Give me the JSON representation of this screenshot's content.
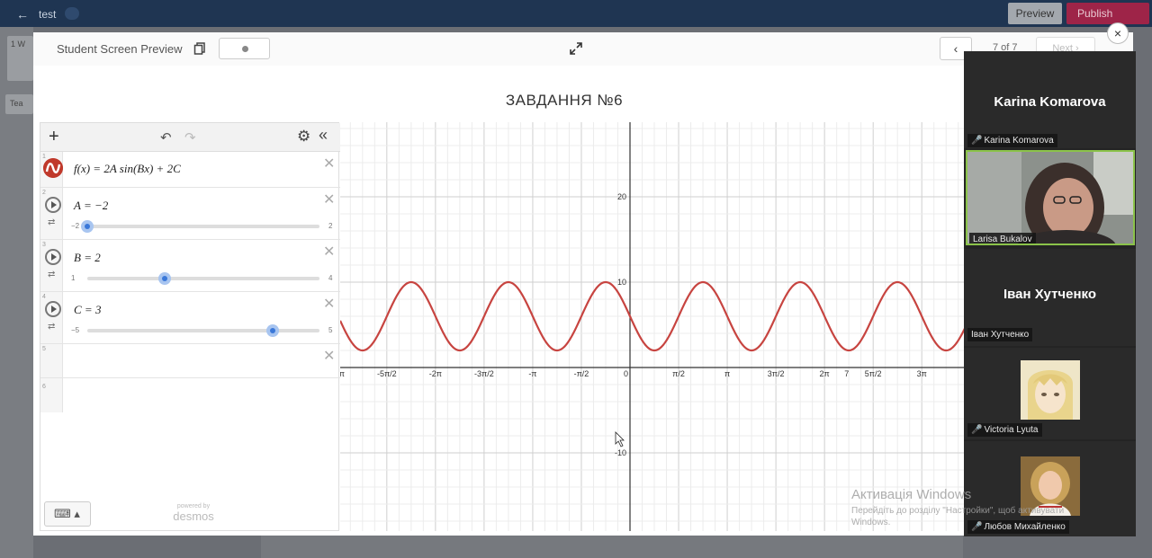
{
  "topbar": {
    "back_glyph": "←",
    "title": "test",
    "preview_label": "Preview",
    "publish_label": "Publish"
  },
  "background": {
    "card_label": "1 W",
    "card2_label": "Tea"
  },
  "header": {
    "preview_title": "Student Screen Preview",
    "page_counter": "7 of 7",
    "next_label": "Next",
    "prev_glyph": "‹",
    "close_glyph": "×"
  },
  "task": {
    "title": "ЗАВДАННЯ №6"
  },
  "expressions": [
    {
      "num": "1",
      "type": "function",
      "latex_text": "f(x) = 2A sin(Bx) + 2C"
    },
    {
      "num": "2",
      "type": "slider",
      "label": "A = −2",
      "min": "−2",
      "max": "2",
      "value": -2,
      "range": [
        -2,
        2
      ]
    },
    {
      "num": "3",
      "type": "slider",
      "label": "B = 2",
      "min": "1",
      "max": "4",
      "value": 2,
      "range": [
        1,
        4
      ]
    },
    {
      "num": "4",
      "type": "slider",
      "label": "C = 3",
      "min": "−5",
      "max": "5",
      "value": 3,
      "range": [
        -5,
        5
      ]
    },
    {
      "num": "5",
      "type": "empty"
    },
    {
      "num": "6",
      "type": "empty"
    }
  ],
  "toolbar": {
    "plus": "+",
    "undo": "↶",
    "redo": "↷",
    "gear": "⚙",
    "collapse": "«"
  },
  "desmos": {
    "powered_by": "powered by",
    "brand": "desmos",
    "keyboard_glyph": "⌨ ▴"
  },
  "chart_data": {
    "type": "line",
    "function": "f(x) = 2A sin(Bx) + 2C",
    "params": {
      "A": -2,
      "B": 2,
      "C": 3
    },
    "x_ticks": [
      "-3π",
      "-5π/2",
      "-2π",
      "-3π/2",
      "-π",
      "-π/2",
      "0",
      "π/2",
      "π",
      "3π/2",
      "2π",
      "5π/2",
      "3π",
      "7"
    ],
    "y_ticks": [
      "20",
      "10",
      "-10"
    ],
    "xlim": [
      -9.7,
      14.5
    ],
    "ylim": [
      -19,
      29
    ],
    "series_color": "#c74440",
    "grid": true
  },
  "participants": [
    {
      "name": "Karina Komarova",
      "big_name": "Karina Komarova",
      "muted": true,
      "video": false
    },
    {
      "name": "Larisa Bukalov",
      "muted": false,
      "video": true
    },
    {
      "name": "Іван Хутченко",
      "big_name": "Іван Хутченко",
      "muted": false,
      "video": false
    },
    {
      "name": "Victoria Lyuta",
      "muted": true,
      "video": false,
      "avatar": "anime-portrait"
    },
    {
      "name": "Любов Михайленко",
      "muted": true,
      "video": false,
      "avatar": "photo-portrait"
    }
  ],
  "watermark": {
    "line1": "Активація Windows",
    "line2": "Перейдіть до розділу \"Настройки\", щоб активувати",
    "line3": "Windows."
  }
}
